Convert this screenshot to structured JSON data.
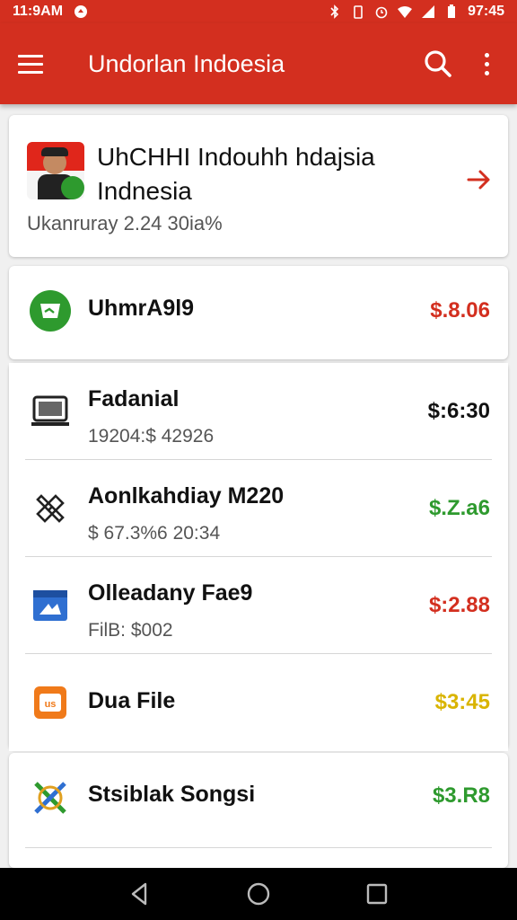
{
  "status": {
    "time": "11:9AM",
    "clock": "97:45",
    "icons": [
      "notification-icon",
      "bluetooth-icon",
      "battery-saver-icon",
      "alarm-icon",
      "wifi-icon",
      "signal-icon",
      "battery-icon"
    ]
  },
  "appbar": {
    "title": "Undorlan Indoesia",
    "bg_color": "#d32f1f"
  },
  "hero": {
    "title": "UhCHHI Indouhh hdajsia Indnesia",
    "subtitle": "Ukanruray 2.24 30ia%"
  },
  "items": [
    {
      "name": "UhmrA9l9",
      "detail": "",
      "price": "$.8.06",
      "price_color": "#d32f1f",
      "icon": "green-chat-icon"
    },
    {
      "name": "Fadanial",
      "detail": "19204:$ 42926",
      "price": "$:6:30",
      "price_color": "#111111",
      "icon": "laptop-icon"
    },
    {
      "name": "Aonlkahdiay M220",
      "detail": "$ 67.3%6 20:34",
      "price": "$.Z.a6",
      "price_color": "#2e9a2e",
      "icon": "puzzle-icon"
    },
    {
      "name": "Olleadany Fae9",
      "detail": "FilB: $002",
      "price": "$:2.88",
      "price_color": "#d32f1f",
      "icon": "browser-icon"
    },
    {
      "name": "Dua File",
      "detail": "",
      "price": "$3:45",
      "price_color": "#d9b400",
      "icon": "orange-file-icon"
    },
    {
      "name": "Stsiblak Songsi",
      "detail": "",
      "price": "$3.R8",
      "price_color": "#2e9a2e",
      "icon": "cross-arrows-icon"
    }
  ]
}
